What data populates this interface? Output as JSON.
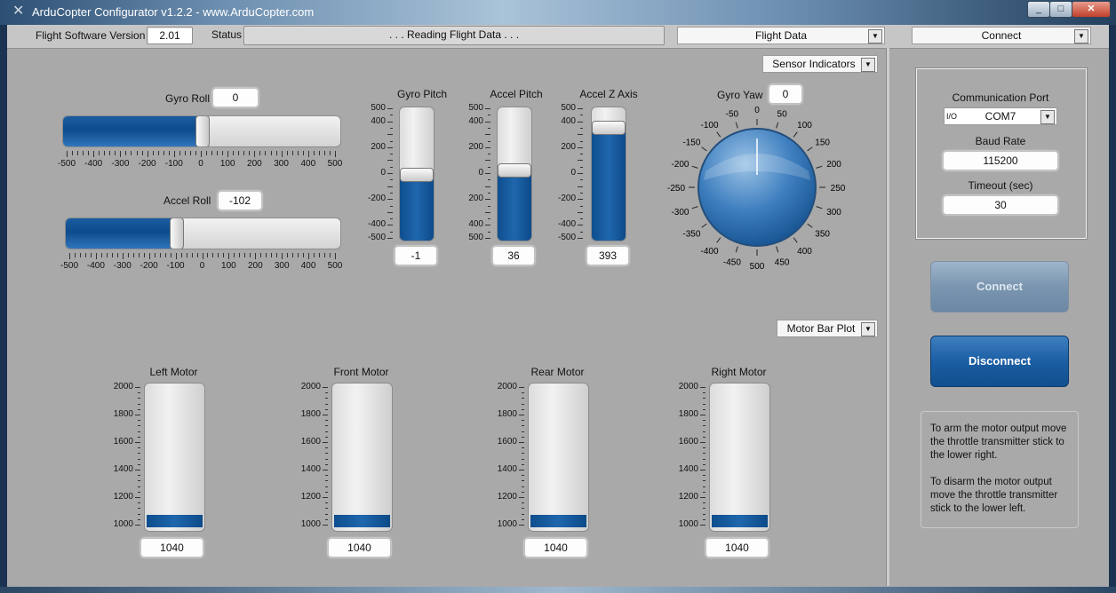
{
  "window": {
    "title": "ArduCopter Configurator v1.2.2 - www.ArduCopter.com",
    "minimize": "_",
    "maximize": "□",
    "close": "✕"
  },
  "topbar": {
    "fsv_label": "Flight Software Version",
    "fsv_value": "2.01",
    "status_label": "Status",
    "status_value": ". . . Reading Flight Data . . .",
    "mode_select": "Flight Data",
    "connect_select": "Connect"
  },
  "sensor": {
    "selector": "Sensor Indicators",
    "gyro_roll": {
      "label": "Gyro Roll",
      "value": "0",
      "level": 0
    },
    "accel_roll": {
      "label": "Accel Roll",
      "value": "-102",
      "level": -102
    },
    "h_ticks": [
      "-500",
      "-400",
      "-300",
      "-200",
      "-100",
      "0",
      "100",
      "200",
      "300",
      "400",
      "500"
    ],
    "gyro_pitch": {
      "label": "Gyro Pitch",
      "value": "-1",
      "level": -1
    },
    "accel_pitch": {
      "label": "Accel Pitch",
      "value": "36",
      "level": 36
    },
    "accel_z": {
      "label": "Accel Z Axis",
      "value": "393",
      "level": 393
    },
    "v_ticks_a": [
      "500",
      "400",
      "200",
      "0",
      "-200",
      "-400",
      "-500"
    ],
    "v_ticks_b": [
      "500",
      "400",
      "200",
      "0",
      "200",
      "400",
      "500"
    ],
    "gyro_yaw": {
      "label": "Gyro Yaw",
      "value": "0"
    },
    "yaw_ticks": [
      "0",
      "50",
      "100",
      "150",
      "200",
      "250",
      "300",
      "350",
      "400",
      "450",
      "500",
      "-450",
      "-400",
      "-350",
      "-300",
      "-250",
      "-200",
      "-150",
      "-100",
      "-50"
    ]
  },
  "motors": {
    "selector": "Motor Bar Plot",
    "ticks": [
      "2000",
      "1800",
      "1600",
      "1400",
      "1200",
      "1000"
    ],
    "range": [
      1000,
      2000
    ],
    "items": [
      {
        "label": "Left Motor",
        "value": "1040",
        "level": 1040
      },
      {
        "label": "Front Motor",
        "value": "1040",
        "level": 1040
      },
      {
        "label": "Rear Motor",
        "value": "1040",
        "level": 1040
      },
      {
        "label": "Right Motor",
        "value": "1040",
        "level": 1040
      }
    ]
  },
  "comm": {
    "port_label": "Communication Port",
    "port_value": "COM7",
    "port_prefix": "I/O",
    "baud_label": "Baud Rate",
    "baud_value": "115200",
    "timeout_label": "Timeout (sec)",
    "timeout_value": "30",
    "connect_btn": "Connect",
    "disconnect_btn": "Disconnect",
    "note_arm": "To arm the motor output move the throttle transmitter stick to the lower right.",
    "note_disarm": "To disarm the motor output move the throttle transmitter stick to the lower left."
  },
  "colors": {
    "accent": "#1a5da0",
    "panel": "#a9a9a9"
  }
}
